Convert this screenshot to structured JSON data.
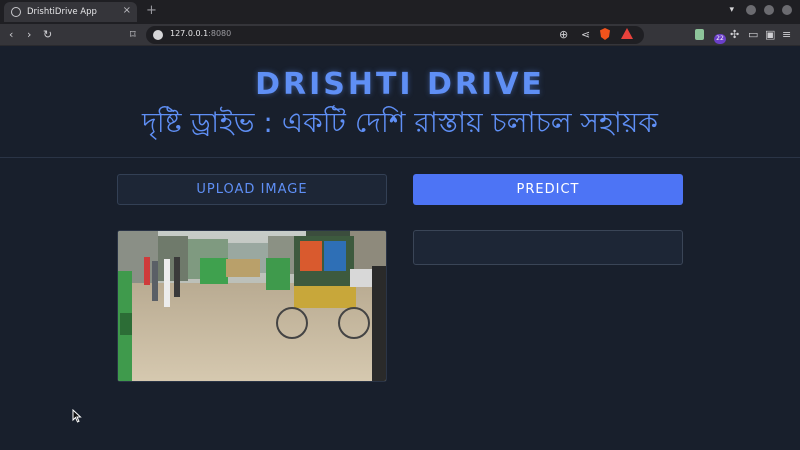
{
  "browser": {
    "tab_title": "DrishtiDrive App",
    "new_tab_icon": "+",
    "close_icon": "×",
    "url_host": "127.0.0.1",
    "url_port": ":8080",
    "extension_badge": "22",
    "colors": {
      "shield": "#f2531c",
      "rewards": "#e8423c",
      "badge": "#6b3fc9"
    }
  },
  "header": {
    "title": "DRISHTI DRIVE",
    "subtitle": "দৃষ্টি ড্রাইভ : একটি দেশি রাস্তায় চলাচল সহায়ক"
  },
  "controls": {
    "upload_label": "UPLOAD IMAGE",
    "predict_label": "PREDICT"
  },
  "preview": {
    "image_icon": "street-scene-image"
  },
  "result": {
    "text": ""
  },
  "theme": {
    "accent": "#5f8ff5",
    "button_primary": "#4d74f5",
    "background": "#181f2c"
  }
}
